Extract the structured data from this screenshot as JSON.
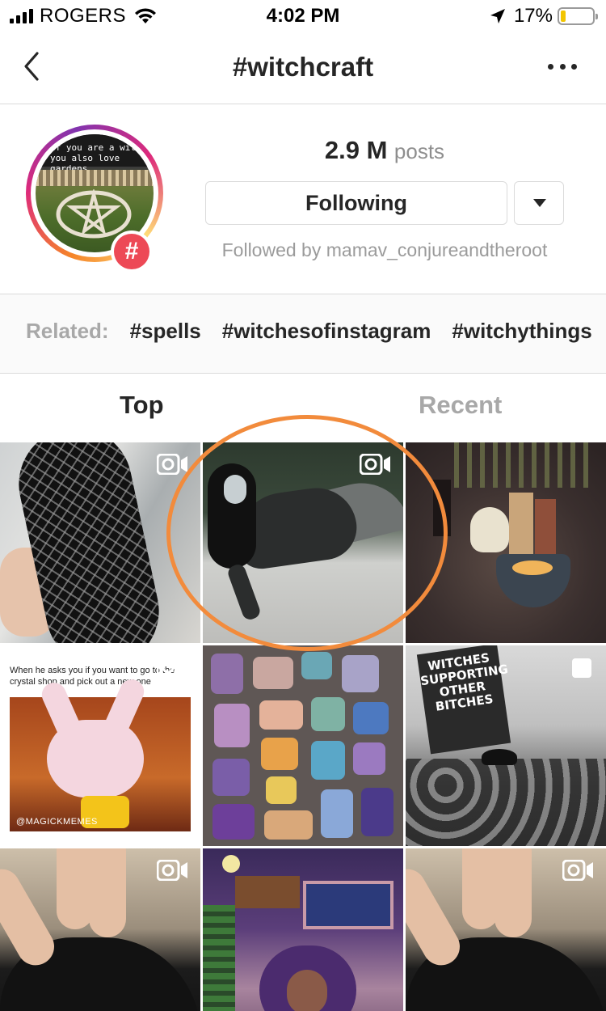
{
  "status_bar": {
    "carrier": "ROGERS",
    "time": "4:02 PM",
    "battery_percent": "17%",
    "battery_level": 0.17,
    "signal_bars": 4,
    "signal_bars_total": 4,
    "icons": [
      "signal-icon",
      "wifi-icon",
      "location-arrow-icon",
      "battery-icon"
    ]
  },
  "nav": {
    "title": "#witchcraft",
    "back_icon": "chevron-left-icon",
    "more_icon": "more-horizontal-icon"
  },
  "header": {
    "avatar_caption": "If you are a witch you also love gardens",
    "badge_symbol": "#",
    "posts_count": "2.9 M",
    "posts_label": "posts",
    "follow_button_label": "Following",
    "followed_by": "Followed by mamav_conjureandtheroot",
    "dropdown_icon": "caret-down-icon"
  },
  "related": {
    "label": "Related:",
    "tags": [
      "#spells",
      "#witchesofinstagram",
      "#witchythings"
    ]
  },
  "tabs": [
    {
      "label": "Top",
      "active": true
    },
    {
      "label": "Recent",
      "active": false
    }
  ],
  "grid": {
    "items": [
      {
        "kind": "video",
        "badge_icon": "video-camera-icon"
      },
      {
        "kind": "video",
        "badge_icon": "video-camera-icon"
      },
      {
        "kind": "image"
      },
      {
        "kind": "video",
        "badge_icon": "video-camera-icon",
        "caption": "When he asks you if you want to go to the crystal shop and pick out a new one",
        "watermark": "@MAGICKMEMES"
      },
      {
        "kind": "image"
      },
      {
        "kind": "carousel",
        "badge_icon": "carousel-icon",
        "sign_text": "WITCHES SUPPORTING OTHER BITCHES"
      },
      {
        "kind": "video",
        "badge_icon": "video-camera-icon"
      },
      {
        "kind": "image"
      },
      {
        "kind": "video",
        "badge_icon": "video-camera-icon"
      }
    ]
  },
  "colors": {
    "accent_hashtag": "#ed4956",
    "highlight_circle": "#f28b3c",
    "battery_fill": "#f2c500",
    "muted_text": "#8e8e8e"
  }
}
